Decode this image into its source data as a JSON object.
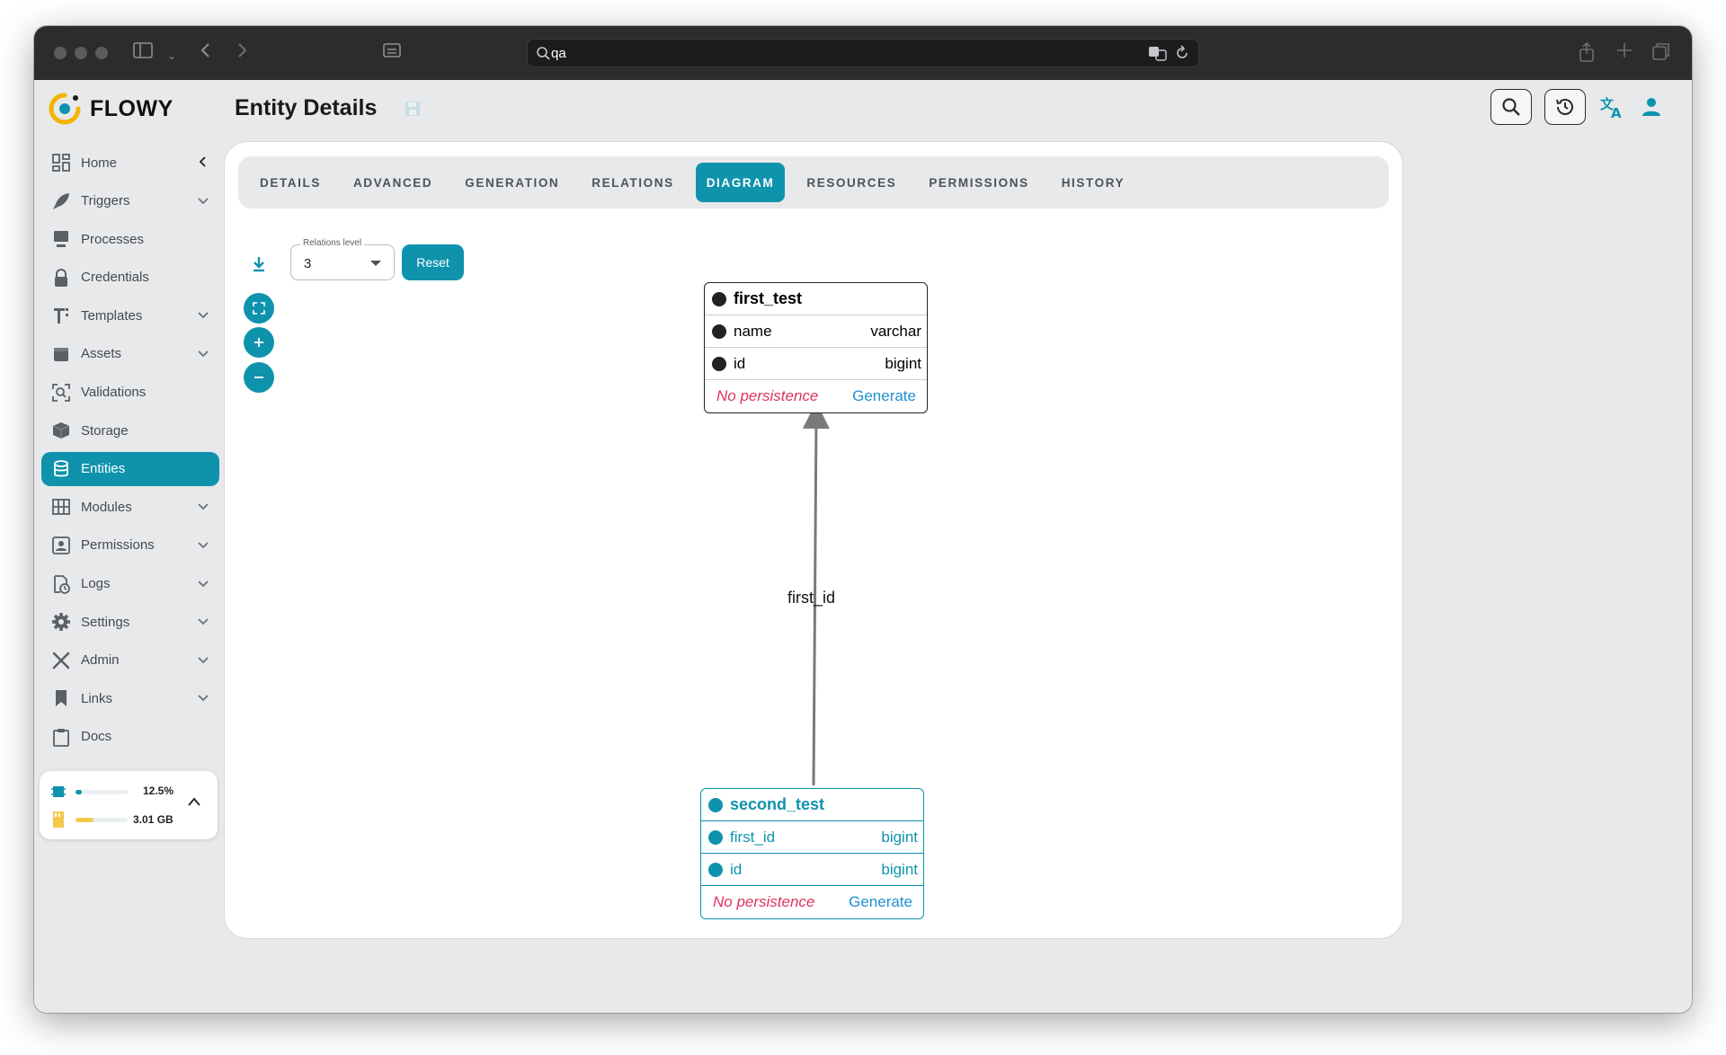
{
  "browser": {
    "url": "qa"
  },
  "app": {
    "brand": "FLOWY",
    "page_title": "Entity Details"
  },
  "sidebar": {
    "items": [
      {
        "label": "Home",
        "icon": "home-grid-icon",
        "chevron": "left"
      },
      {
        "label": "Triggers",
        "icon": "rocket-icon",
        "chevron": "down"
      },
      {
        "label": "Processes",
        "icon": "process-icon",
        "chevron": ""
      },
      {
        "label": "Credentials",
        "icon": "lock-icon",
        "chevron": ""
      },
      {
        "label": "Templates",
        "icon": "template-icon",
        "chevron": "down"
      },
      {
        "label": "Assets",
        "icon": "assets-icon",
        "chevron": "down"
      },
      {
        "label": "Validations",
        "icon": "validation-icon",
        "chevron": ""
      },
      {
        "label": "Storage",
        "icon": "storage-cube-icon",
        "chevron": ""
      },
      {
        "label": "Entities",
        "icon": "database-icon",
        "chevron": "",
        "active": true
      },
      {
        "label": "Modules",
        "icon": "modules-grid-icon",
        "chevron": "down"
      },
      {
        "label": "Permissions",
        "icon": "permissions-icon",
        "chevron": "down"
      },
      {
        "label": "Logs",
        "icon": "logs-icon",
        "chevron": "down"
      },
      {
        "label": "Settings",
        "icon": "gear-icon",
        "chevron": "down"
      },
      {
        "label": "Admin",
        "icon": "tools-icon",
        "chevron": "down"
      },
      {
        "label": "Links",
        "icon": "bookmark-icon",
        "chevron": "down"
      },
      {
        "label": "Docs",
        "icon": "clipboard-icon",
        "chevron": ""
      }
    ],
    "usage": {
      "cpu_value": "12.5%",
      "cpu_fraction": 0.125,
      "memory_value": "3.01 GB",
      "memory_fraction": 0.35
    }
  },
  "tabs": [
    "DETAILS",
    "ADVANCED",
    "GENERATION",
    "RELATIONS",
    "DIAGRAM",
    "RESOURCES",
    "PERMISSIONS",
    "HISTORY"
  ],
  "active_tab": "DIAGRAM",
  "diagram_toolbar": {
    "relations_level_label": "Relations level",
    "relations_level_value": "3",
    "reset_label": "Reset"
  },
  "diagram": {
    "entities": [
      {
        "name": "first_test",
        "fields": [
          {
            "name": "name",
            "type": "varchar"
          },
          {
            "name": "id",
            "type": "bigint"
          }
        ],
        "persistence": "No persistence",
        "action": "Generate"
      },
      {
        "name": "second_test",
        "fields": [
          {
            "name": "first_id",
            "type": "bigint"
          },
          {
            "name": "id",
            "type": "bigint"
          }
        ],
        "persistence": "No persistence",
        "action": "Generate"
      }
    ],
    "relation_label": "first_id"
  },
  "colors": {
    "accent": "#0f93ad",
    "persistence_warning": "#e0325f",
    "generate_link": "#1f8fd1",
    "memory_bar": "#f2c94c"
  }
}
